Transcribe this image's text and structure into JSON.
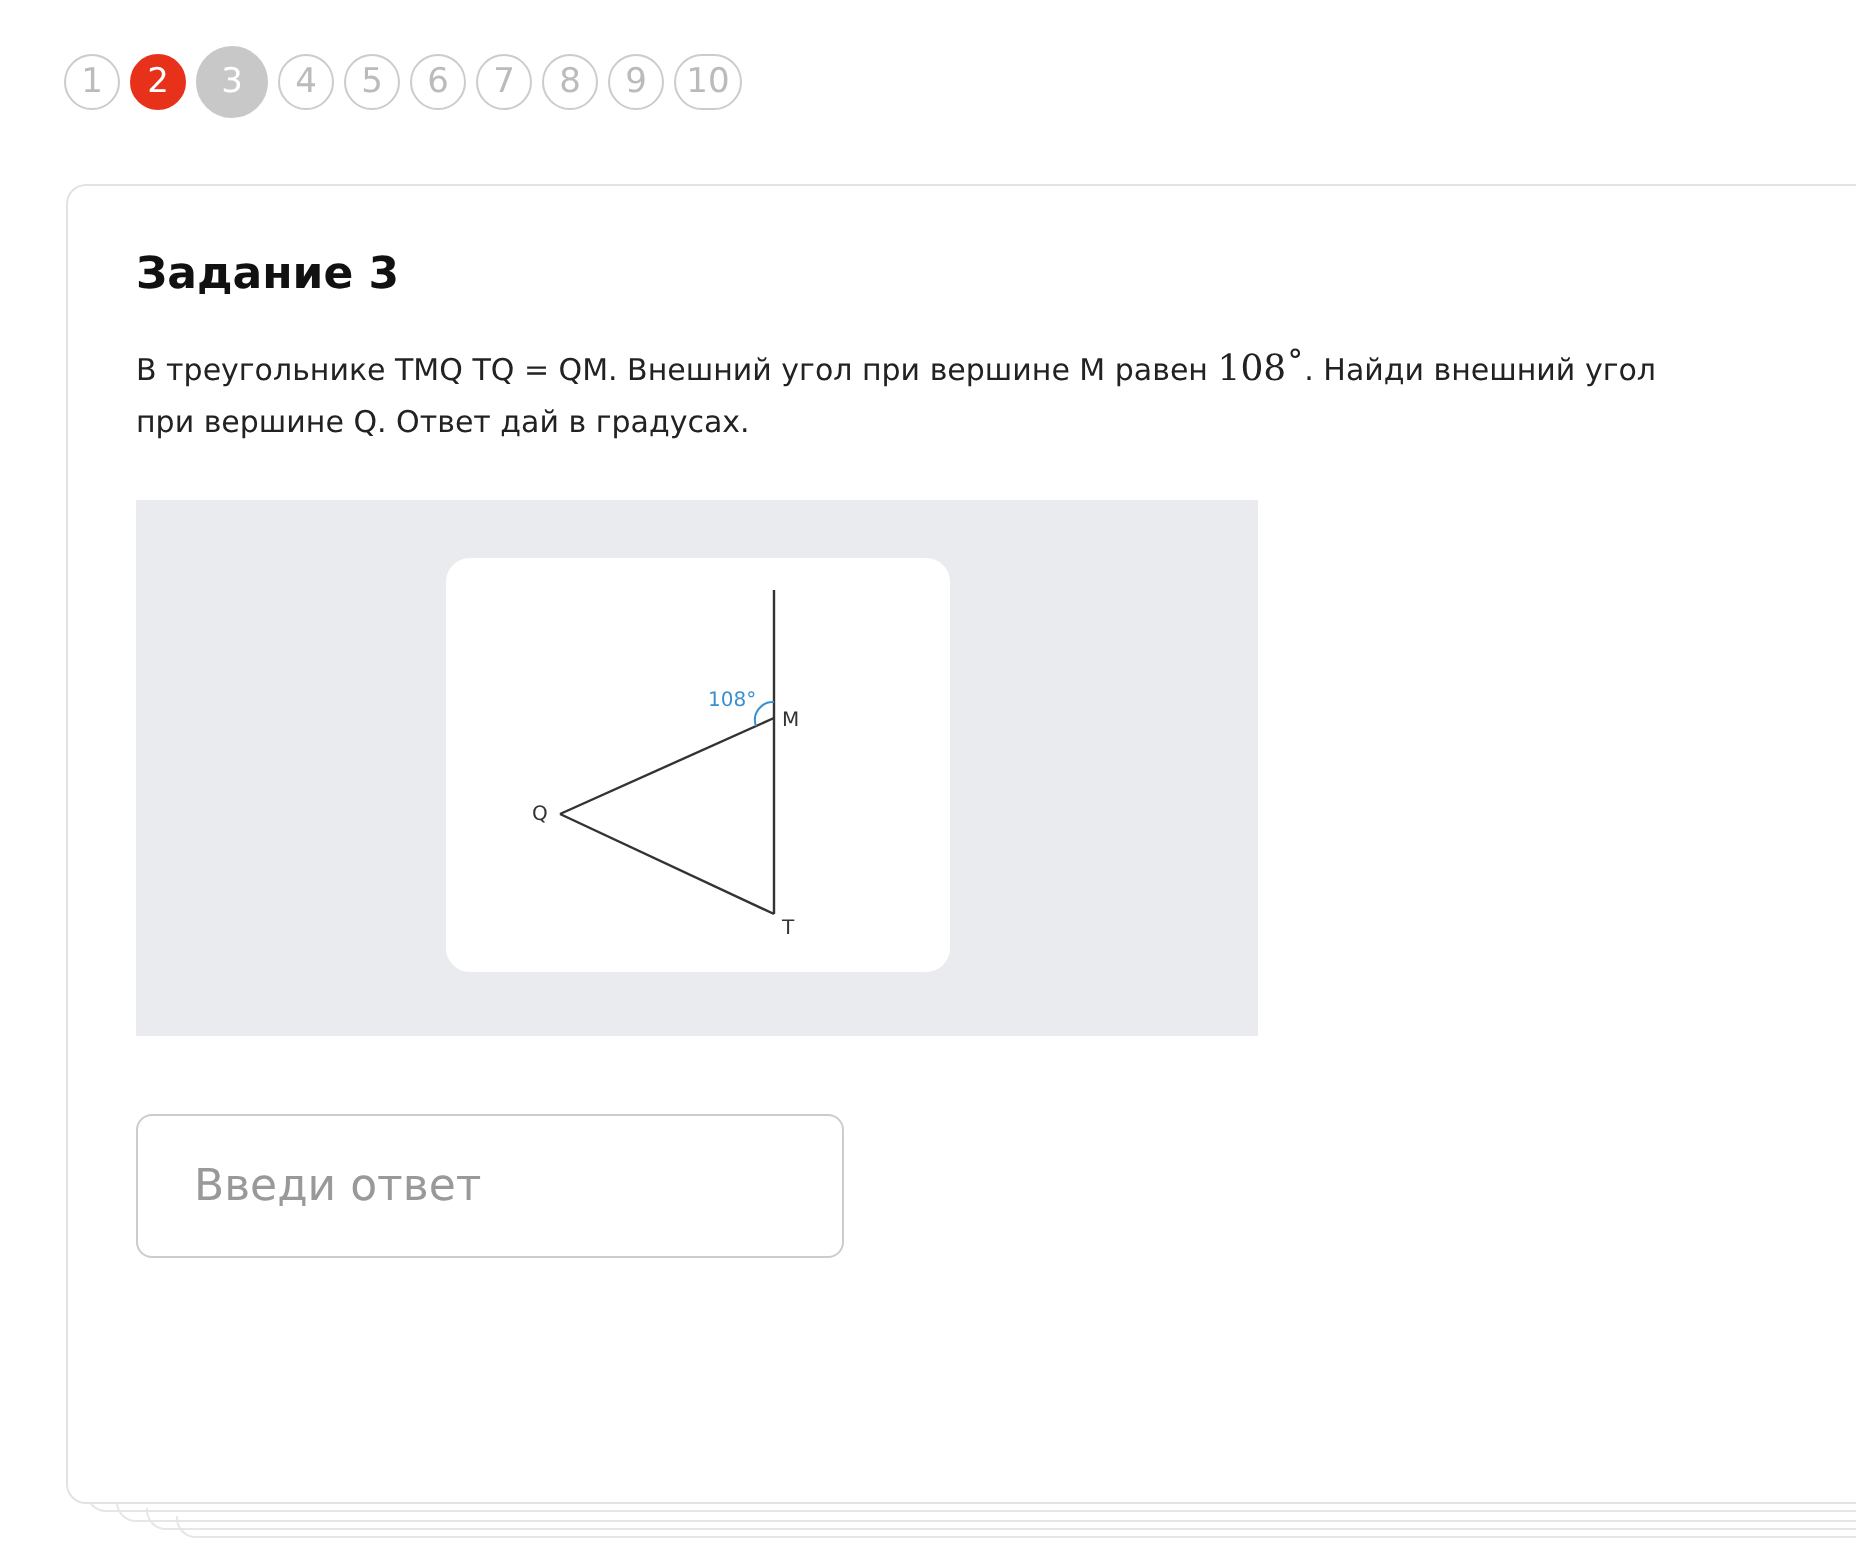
{
  "pagination": [
    {
      "label": "1",
      "selected": false
    },
    {
      "label": "2",
      "selected": false,
      "color": "#e8311a"
    },
    {
      "label": "3",
      "selected": true
    },
    {
      "label": "4",
      "selected": false
    },
    {
      "label": "5",
      "selected": false
    },
    {
      "label": "6",
      "selected": false
    },
    {
      "label": "7",
      "selected": false
    },
    {
      "label": "8",
      "selected": false
    },
    {
      "label": "9",
      "selected": false
    },
    {
      "label": "10",
      "selected": false
    }
  ],
  "task": {
    "title": "Задание 3",
    "question": {
      "before": "В треугольнике TMQ TQ = QM. Внешний угол при вершине M равен ",
      "math": "108˚",
      "after": ". Найди внешний угол при вершине Q. Ответ дай в градусах."
    },
    "figure": {
      "angle_label": "108°",
      "vertices": [
        "M",
        "Q",
        "T"
      ]
    },
    "answer": {
      "placeholder": "Введи ответ"
    }
  }
}
